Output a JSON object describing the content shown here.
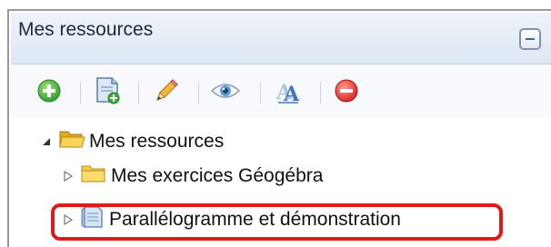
{
  "panel": {
    "title": "Mes ressources"
  },
  "toolbar": {
    "buttons": [
      {
        "name": "add-icon",
        "color": "#5cb83a"
      },
      {
        "name": "new-document-icon",
        "color": "#3b9a3b"
      },
      {
        "name": "edit-pencil-icon",
        "color": "#e8a63a"
      },
      {
        "name": "preview-eye-icon",
        "color": "#4a90d9"
      },
      {
        "name": "rename-text-icon",
        "color": "#4a86c8"
      },
      {
        "name": "delete-icon",
        "color": "#e23b3b"
      }
    ]
  },
  "tree": {
    "root": {
      "label": "Mes ressources",
      "expanded": true,
      "icon": "folder-open-icon"
    },
    "children": [
      {
        "label": "Mes exercices Géogébra",
        "icon": "folder-icon",
        "expanded": false
      },
      {
        "label": "Parallélogramme et démonstration",
        "icon": "document-icon",
        "expanded": false
      }
    ]
  },
  "colors": {
    "highlight_border": "#e01a1a",
    "folder": "#f5c83a",
    "header_bg": "#e6eef7"
  }
}
